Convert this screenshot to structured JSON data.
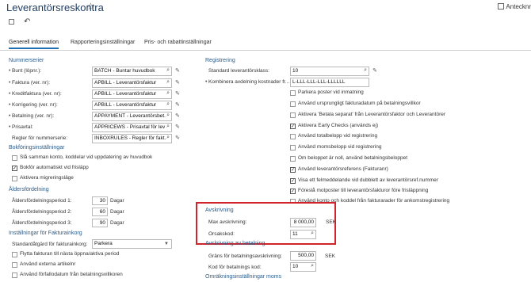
{
  "header": {
    "title": "Leverantörsreskontra",
    "right_action": "Antecknr"
  },
  "tabs": [
    "Generell information",
    "Rapporteringsinställningar",
    "Pris- och rabattinställningar"
  ],
  "numbering": {
    "heading": "Nummerserier",
    "rows": [
      {
        "label": "Bunt (löpnr.):",
        "value": "BATCH - Buntar huvudbok"
      },
      {
        "label": "Faktura (ver. nr):",
        "value": "APBILL - Leverantörsfaktur"
      },
      {
        "label": "Kreditfaktura (ver. nr):",
        "value": "APBILL - Leverantörsfaktur"
      },
      {
        "label": "Korrigering (ver. nr):",
        "value": "APBILL - Leverantörsfaktur"
      },
      {
        "label": "Betalning (ver. nr):",
        "value": "APPAYMENT - Leverantörsbet."
      },
      {
        "label": "Prisavtal:",
        "value": "APPRICEWS - Prisavtal för lev"
      },
      {
        "label": "Regler för nummerserie:",
        "value": "INBOXRULES - Regler för fakt."
      }
    ]
  },
  "booking": {
    "heading": "Bokföringsinställningar",
    "options": [
      {
        "label": "Slå samman konto, koddelar vid uppdatering av huvudbok",
        "checked": false
      },
      {
        "label": "Bokför automatiskt vid frisläpp",
        "checked": true
      },
      {
        "label": "Aktivera migreringsläge",
        "checked": false
      }
    ]
  },
  "aging": {
    "heading": "Åldersfördelning",
    "rows": [
      {
        "label": "Åldersfördelningsperiod 1:",
        "value": "30",
        "unit": "Dagar"
      },
      {
        "label": "Åldersfördelningsperiod 2:",
        "value": "60",
        "unit": "Dagar"
      },
      {
        "label": "Åldersfördelningsperiod 3:",
        "value": "90",
        "unit": "Dagar"
      }
    ]
  },
  "invoice_inbox": {
    "heading": "Inställningar för Fakturainkorg",
    "standard_label": "Standardåtgärd för fakturainkorg:",
    "standard_value": "Parkera",
    "options": [
      {
        "label": "Flytta fakturan till nästa öppna/aktiva period",
        "checked": false
      },
      {
        "label": "Använd externa artikelnr",
        "checked": false
      },
      {
        "label": "Använd förfallodatum från betalningsvillkoren",
        "checked": false
      }
    ]
  },
  "registration": {
    "heading": "Registrering",
    "default_class_label": "Standard leverantörsklass:",
    "default_class_value": "10",
    "combine_label": "Kombinera avdelning kostnader fr...",
    "combine_value": "L-LLL-LLL-LLL-LLLLLL",
    "options": [
      {
        "label": "Parkera poster vid inmatning",
        "checked": false
      },
      {
        "label": "Använd ursprungligt fakturadatum på betalningsvillkor",
        "checked": false
      },
      {
        "label": "Aktivera 'Betala separat' från Leverantörsfaktor och Leverantörer",
        "checked": false
      },
      {
        "label": "Aktivera Early Checks (används ej)",
        "checked": true
      },
      {
        "label": "Använd totalbelopp vid registrering",
        "checked": false
      },
      {
        "label": "Använd momsbelopp vid registrering",
        "checked": false
      },
      {
        "label": "Om beloppet är noll, använd betalningsbeloppet",
        "checked": false
      },
      {
        "label": "Använd leverantörsreferens (Fakturanr)",
        "checked": true
      },
      {
        "label": "Visa ett felmeddelande vid dubblett av leverantörsref.nummer",
        "checked": true
      },
      {
        "label": "Föreslå motposter till leverantörsfakturor före frisläppning",
        "checked": true
      },
      {
        "label": "Använd konto och koddel från fakturarader för ankomstregistrering",
        "checked": false
      }
    ]
  },
  "writeoff": {
    "heading": "Avskrivning",
    "max_label": "Max avskrivning:",
    "max_value": "8 000,00",
    "max_unit": "SEK",
    "reason_label": "Orsakskod:",
    "reason_value": "11"
  },
  "payment_writeoff": {
    "heading": "Avskrivning av betalning",
    "limit_label": "Gräns för betalningsavskrivning:",
    "limit_value": "500,00",
    "limit_unit": "SEK",
    "code_label": "Kod för betalnings kod:",
    "code_value": "10"
  },
  "conversion": {
    "heading": "Omräkningsinställningar moms"
  }
}
